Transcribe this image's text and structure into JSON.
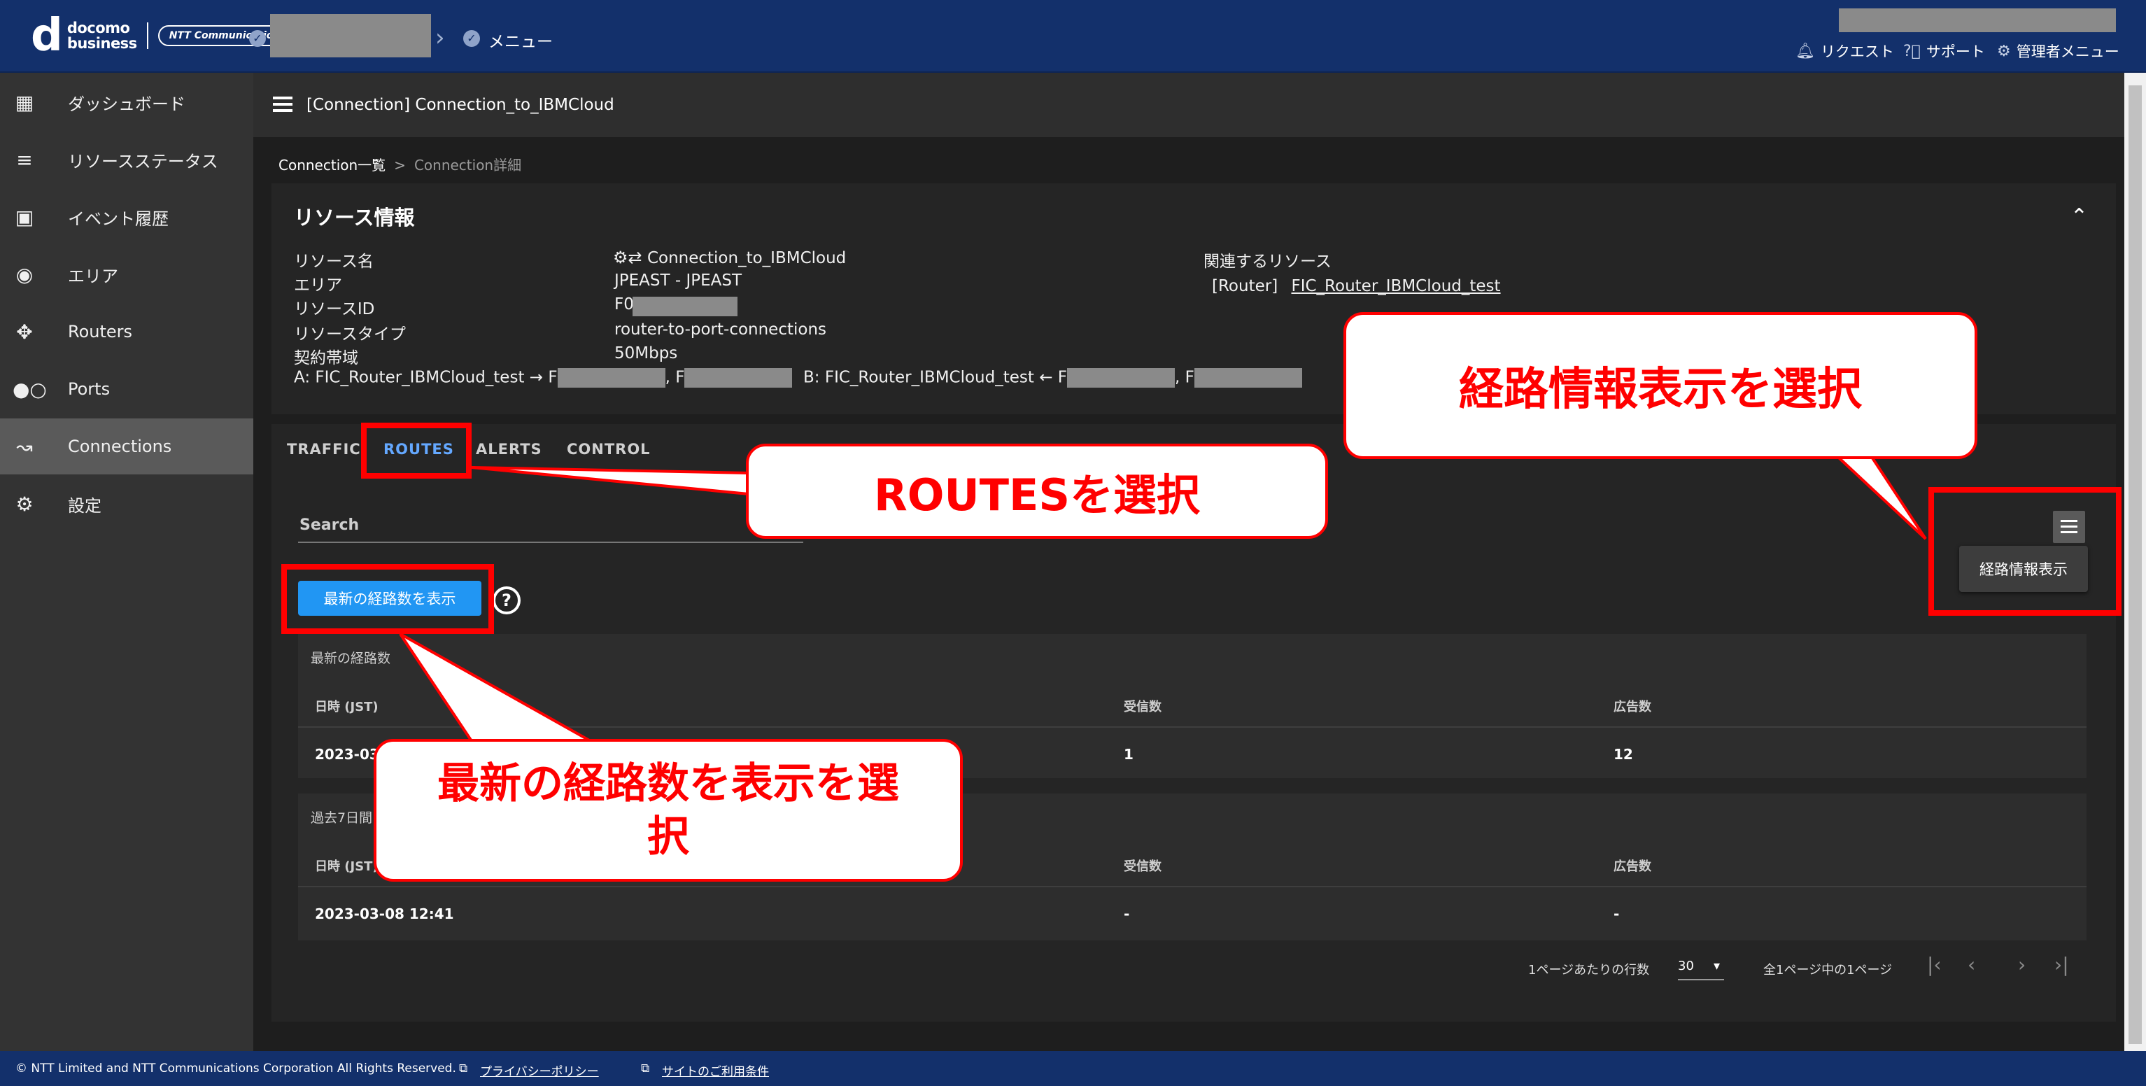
{
  "header": {
    "brand_top": "docomo",
    "brand_bottom": "business",
    "partner": "NTT Communications",
    "menu_label": "メニュー",
    "request": "リクエスト",
    "support": "サポート",
    "admin_menu": "管理者メニュー"
  },
  "sidebar": {
    "items": [
      {
        "label": "ダッシュボード",
        "icon": "grid-icon"
      },
      {
        "label": "リソースステータス",
        "icon": "status-list-icon"
      },
      {
        "label": "イベント履歴",
        "icon": "calendar-icon"
      },
      {
        "label": "エリア",
        "icon": "globe-icon"
      },
      {
        "label": "Routers",
        "icon": "router-icon"
      },
      {
        "label": "Ports",
        "icon": "port-icon"
      },
      {
        "label": "Connections",
        "icon": "connection-icon"
      },
      {
        "label": "設定",
        "icon": "gear-icon"
      }
    ],
    "active": "Connections"
  },
  "main": {
    "title": "[Connection] Connection_to_IBMCloud",
    "breadcrumb": {
      "parent": "Connection一覧",
      "sep": ">",
      "current": "Connection詳細"
    }
  },
  "resource": {
    "title": "リソース情報",
    "labels": {
      "name": "リソース名",
      "area": "エリア",
      "id": "リソースID",
      "type": "リソースタイプ",
      "bandwidth": "契約帯域",
      "related": "関連するリソース"
    },
    "values": {
      "name": "Connection_to_IBMCloud",
      "area": "JPEAST - JPEAST",
      "id": "F0",
      "type": "router-to-port-connections",
      "bandwidth": "50Mbps",
      "related_prefix": "[Router]",
      "related_link": "FIC_Router_IBMCloud_test"
    },
    "endpoint_a": {
      "text": "A: FIC_Router_IBMCloud_test → F",
      "mid": ", F"
    },
    "endpoint_b": {
      "text": "B: FIC_Router_IBMCloud_test ← F",
      "mid": ", F"
    }
  },
  "tabs": [
    "TRAFFIC",
    "ROUTES",
    "ALERTS",
    "CONTROL"
  ],
  "active_tab": "ROUTES",
  "search": {
    "label": "Search"
  },
  "latest_button": "最新の経路数を表示",
  "route_menu_item": "経路情報表示",
  "latest_table": {
    "caption": "最新の経路数",
    "headers": [
      "日時 (JST)",
      "受信数",
      "広告数"
    ],
    "rows": [
      [
        "2023-03-",
        "1",
        "12"
      ]
    ]
  },
  "history_table": {
    "caption": "過去7日間",
    "headers": [
      "日時 (JST)",
      "受信数",
      "広告数"
    ],
    "rows": [
      [
        "2023-03-08 12:41",
        "-",
        "-"
      ]
    ]
  },
  "pagination": {
    "rows_per_page_label": "1ページあたりの行数",
    "rows_per_page": "30",
    "summary": "全1ページ中の1ページ"
  },
  "footer": {
    "copyright": "© NTT Limited and NTT Communications Corporation All Rights Reserved.",
    "privacy": "プライバシーポリシー",
    "terms": "サイトのご利用条件"
  },
  "annotations": {
    "routes": "ROUTESを選択",
    "route_info": "経路情報表示を選択",
    "latest": "最新の経路数を表示を選択"
  },
  "colors": {
    "header_bg": "#13306b",
    "accent": "#2196f3",
    "active_tab": "#64a8ff",
    "callout_red": "#ff0000"
  }
}
